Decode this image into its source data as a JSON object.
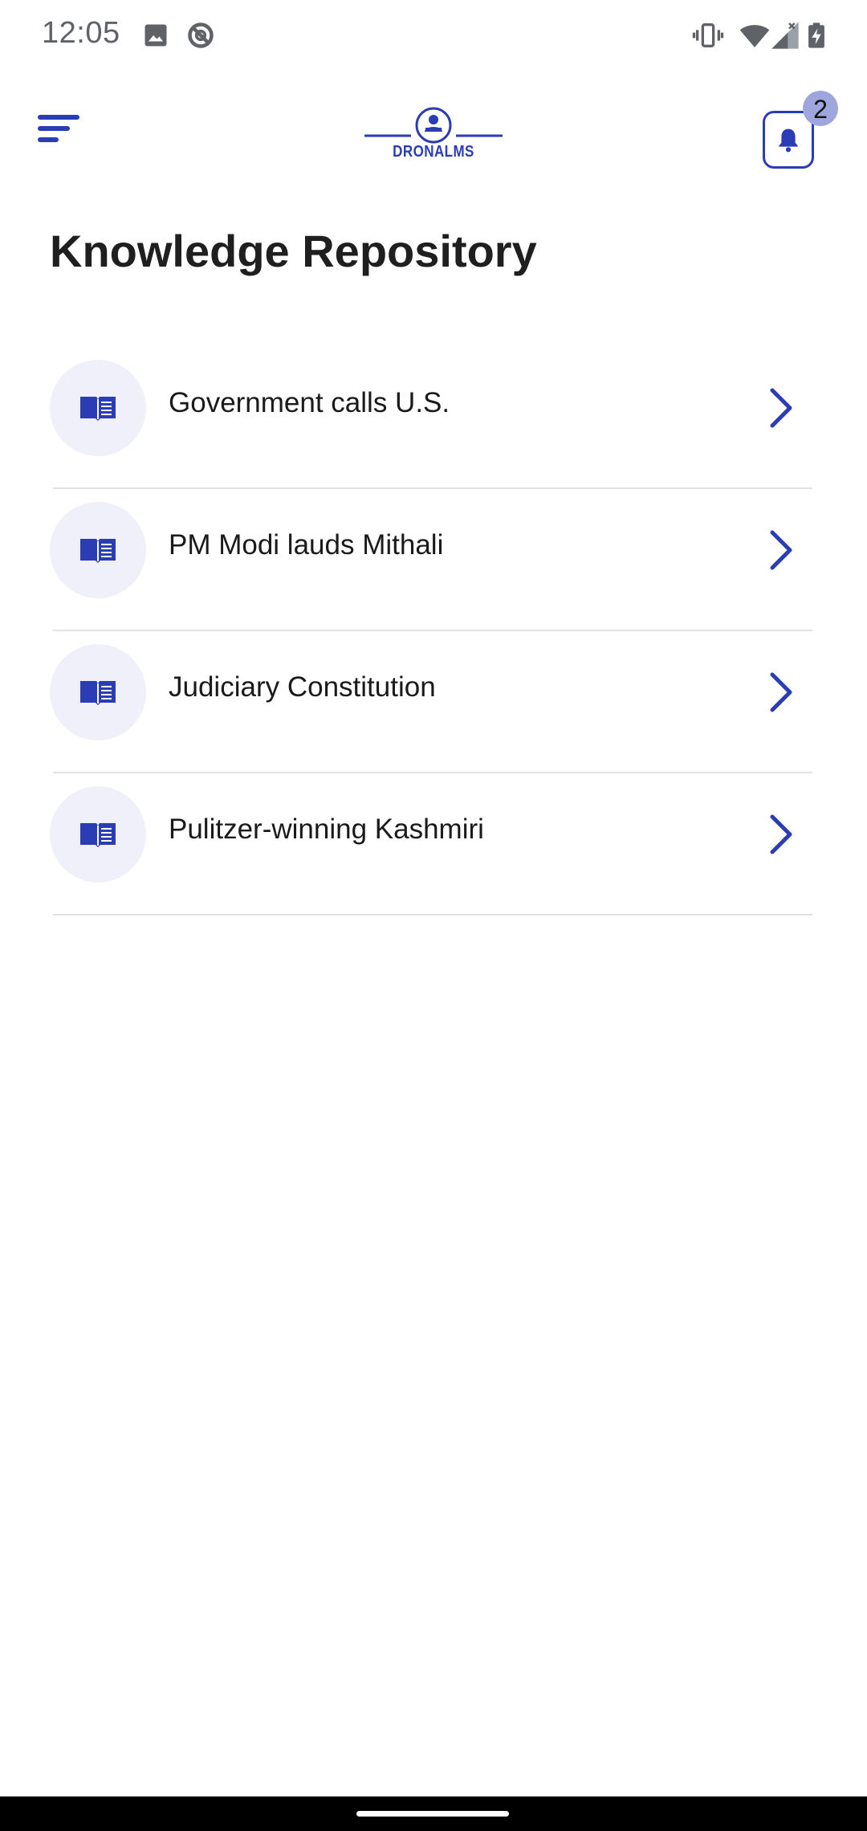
{
  "status_bar": {
    "time": "12:05",
    "left_icons": [
      "image-icon",
      "do-not-disturb-icon"
    ],
    "right_icons": [
      "vibrate-icon",
      "wifi-icon",
      "signal-icon",
      "battery-charging-icon"
    ]
  },
  "header": {
    "logo_text": "DRONALMS",
    "notification_count": "2",
    "brand_color": "#2b3db4"
  },
  "page": {
    "title": "Knowledge Repository"
  },
  "repository": {
    "items": [
      {
        "label": "Government calls U.S.",
        "icon": "book-icon"
      },
      {
        "label": "PM Modi lauds Mithali",
        "icon": "book-icon"
      },
      {
        "label": "Judiciary Constitution",
        "icon": "book-icon"
      },
      {
        "label": "Pulitzer-winning Kashmiri",
        "icon": "book-icon"
      }
    ]
  }
}
